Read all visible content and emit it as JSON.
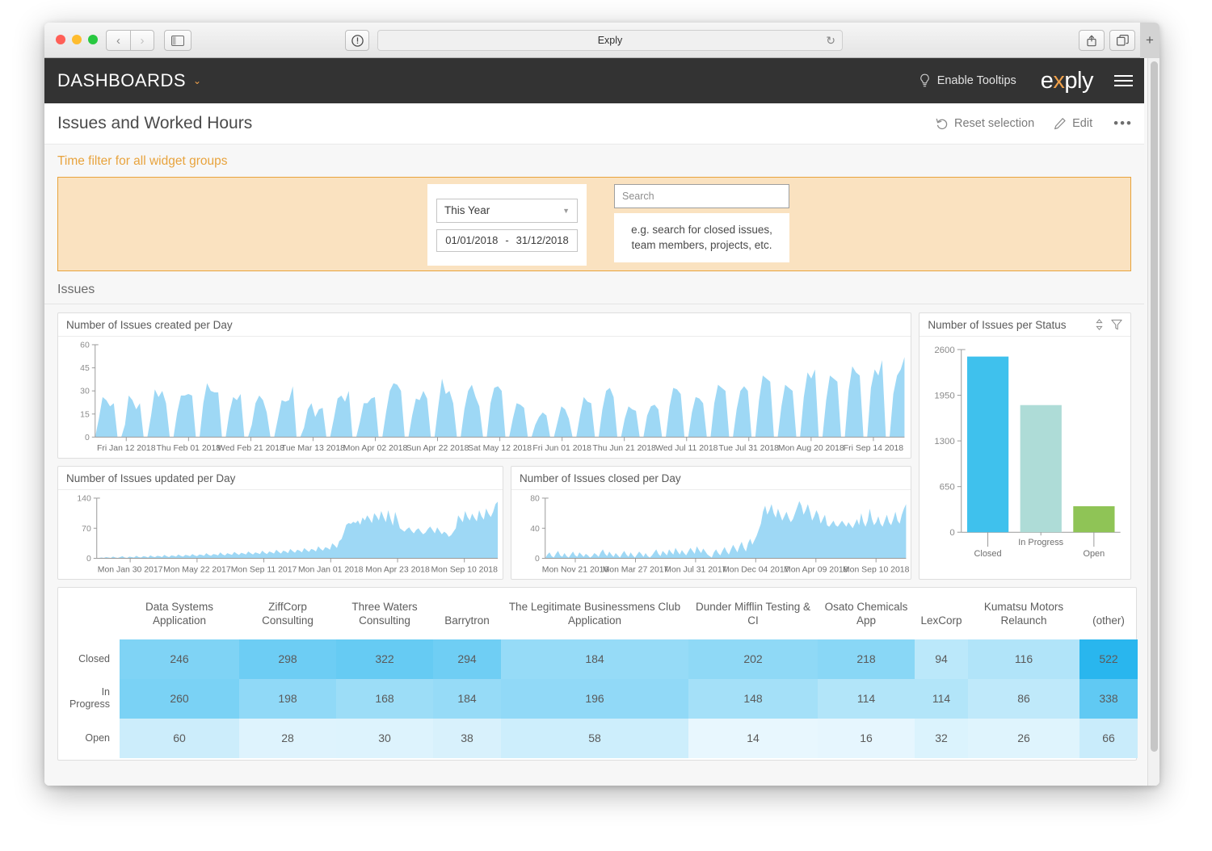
{
  "browser": {
    "traffic_lights": [
      "close",
      "minimize",
      "maximize"
    ],
    "back_label": "‹",
    "forward_label": "›",
    "url_text": "Exply",
    "reload_label": "↻",
    "newtab_label": "+"
  },
  "appbar": {
    "brand": "DASHBOARDS",
    "brand_caret": "⌄",
    "tooltips_label": "Enable Tooltips",
    "logo_pre": "e",
    "logo_x": "x",
    "logo_post": "ply"
  },
  "title_row": {
    "dashboard_title": "Issues and Worked Hours",
    "reset_label": "Reset selection",
    "edit_label": "Edit",
    "more_label": "•••"
  },
  "time_filter": {
    "caption": "Time filter for all widget groups",
    "period_value": "This Year",
    "period_options": [
      "This Year"
    ],
    "date_from": "01/01/2018",
    "date_sep": "-",
    "date_to": "31/12/2018",
    "search_placeholder": "Search",
    "search_value": "",
    "search_hint_line1": "e.g. search for closed issues,",
    "search_hint_line2": "team members, projects, etc."
  },
  "group": {
    "label": "Issues"
  },
  "colors": {
    "accent_orange": "#e8a33d",
    "panel_bg": "#fae2c0",
    "appbar_bg": "#333333",
    "area_blue": "#9ed8f5",
    "bar_closed": "#3fc1ed",
    "bar_inprogress": "#aedcd7",
    "bar_open": "#8fc456"
  },
  "widgets": {
    "created": {
      "title": "Number of Issues created per Day"
    },
    "updated": {
      "title": "Number of Issues updated per Day"
    },
    "closed": {
      "title": "Number of Issues closed per Day"
    },
    "status": {
      "title": "Number of Issues per Status"
    }
  },
  "chart_data": [
    {
      "id": "issues-created-per-day",
      "type": "area",
      "title": "Number of Issues created per Day",
      "xlabel": "",
      "ylabel": "",
      "ylim": [
        0,
        60
      ],
      "yticks": [
        0,
        15,
        30,
        45,
        60
      ],
      "grid": false,
      "legend": "none",
      "xticks": [
        "Fri Jan 12 2018",
        "Thu Feb 01 2018",
        "Wed Feb 21 2018",
        "Tue Mar 13 2018",
        "Mon Apr 02 2018",
        "Sun Apr 22 2018",
        "Sat May 12 2018",
        "Fri Jun 01 2018",
        "Thu Jun 21 2018",
        "Wed Jul 11 2018",
        "Tue Jul 31 2018",
        "Mon Aug 20 2018",
        "Fri Sep 14 2018"
      ],
      "values": [
        0,
        12,
        26,
        24,
        20,
        22,
        0,
        0,
        8,
        27,
        24,
        18,
        22,
        0,
        0,
        14,
        31,
        26,
        30,
        22,
        0,
        0,
        16,
        27,
        27,
        28,
        27,
        0,
        0,
        22,
        35,
        30,
        29,
        29,
        0,
        0,
        16,
        26,
        24,
        28,
        0,
        0,
        8,
        22,
        27,
        24,
        16,
        0,
        0,
        12,
        24,
        23,
        24,
        33,
        0,
        0,
        6,
        18,
        22,
        13,
        18,
        19,
        0,
        0,
        12,
        25,
        27,
        23,
        30,
        0,
        0,
        10,
        22,
        22,
        25,
        26,
        0,
        0,
        16,
        30,
        35,
        34,
        30,
        0,
        0,
        14,
        25,
        24,
        30,
        25,
        0,
        0,
        20,
        38,
        28,
        30,
        22,
        0,
        0,
        18,
        30,
        34,
        26,
        20,
        0,
        0,
        22,
        32,
        33,
        30,
        0,
        0,
        12,
        22,
        21,
        19,
        0,
        0,
        8,
        13,
        16,
        14,
        0,
        0,
        10,
        20,
        18,
        12,
        0,
        0,
        14,
        26,
        23,
        22,
        0,
        0,
        18,
        30,
        32,
        26,
        0,
        0,
        12,
        20,
        18,
        17,
        0,
        0,
        14,
        20,
        21,
        18,
        0,
        0,
        20,
        32,
        31,
        28,
        0,
        0,
        16,
        26,
        25,
        22,
        0,
        0,
        22,
        34,
        32,
        30,
        0,
        0,
        18,
        30,
        33,
        30,
        0,
        0,
        24,
        40,
        38,
        36,
        0,
        0,
        20,
        34,
        32,
        30,
        0,
        0,
        26,
        42,
        38,
        44,
        0,
        0,
        24,
        40,
        38,
        36,
        0,
        0,
        30,
        46,
        42,
        40,
        0,
        0,
        32,
        44,
        40,
        50,
        0,
        0,
        28,
        40,
        44,
        52
      ]
    },
    {
      "id": "issues-updated-per-day",
      "type": "area",
      "title": "Number of Issues updated per Day",
      "ylim": [
        0,
        140
      ],
      "yticks": [
        0,
        70,
        140
      ],
      "grid": false,
      "legend": "none",
      "xticks": [
        "Mon Jan 30 2017",
        "Mon May 22 2017",
        "Mon Sep 11 2017",
        "Mon Jan 01 2018",
        "Mon Apr 23 2018",
        "Mon Sep 10 2018"
      ],
      "values": [
        0,
        1,
        2,
        1,
        3,
        2,
        1,
        4,
        2,
        1,
        3,
        5,
        2,
        1,
        4,
        3,
        2,
        6,
        3,
        2,
        5,
        4,
        2,
        7,
        4,
        3,
        6,
        5,
        3,
        8,
        5,
        3,
        7,
        6,
        4,
        9,
        6,
        4,
        8,
        7,
        5,
        10,
        7,
        5,
        9,
        8,
        6,
        12,
        8,
        6,
        10,
        9,
        7,
        14,
        9,
        7,
        12,
        10,
        8,
        15,
        11,
        8,
        13,
        11,
        9,
        16,
        12,
        9,
        14,
        12,
        10,
        18,
        13,
        10,
        16,
        14,
        11,
        20,
        15,
        11,
        18,
        16,
        12,
        22,
        17,
        13,
        20,
        18,
        14,
        24,
        19,
        15,
        22,
        20,
        16,
        28,
        22,
        18,
        26,
        24,
        20,
        35,
        30,
        24,
        40,
        45,
        60,
        78,
        82,
        80,
        85,
        82,
        88,
        78,
        95,
        88,
        100,
        92,
        82,
        105,
        98,
        88,
        110,
        96,
        84,
        112,
        92,
        76,
        108,
        90,
        70,
        66,
        62,
        68,
        72,
        64,
        58,
        66,
        70,
        62,
        56,
        60,
        68,
        74,
        66,
        58,
        72,
        64,
        56,
        62,
        58,
        50,
        54,
        62,
        70,
        100,
        92,
        84,
        110,
        96,
        88,
        104,
        94,
        86,
        112,
        98,
        90,
        116,
        104,
        96,
        108,
        126,
        132
      ]
    },
    {
      "id": "issues-closed-per-day",
      "type": "area",
      "title": "Number of Issues closed per Day",
      "ylim": [
        0,
        80
      ],
      "yticks": [
        0,
        40,
        80
      ],
      "grid": false,
      "legend": "none",
      "xticks": [
        "Mon Nov 21 2016",
        "Mon Mar 27 2017",
        "Mon Jul 31 2017",
        "Mon Dec 04 2017",
        "Mon Apr 09 2018",
        "Mon Sep 10 2018"
      ],
      "values": [
        0,
        5,
        8,
        3,
        1,
        6,
        10,
        4,
        2,
        7,
        3,
        1,
        5,
        9,
        4,
        2,
        8,
        5,
        2,
        6,
        4,
        1,
        3,
        7,
        5,
        2,
        8,
        12,
        6,
        3,
        9,
        5,
        2,
        7,
        4,
        1,
        6,
        10,
        5,
        2,
        8,
        4,
        1,
        5,
        9,
        6,
        2,
        7,
        3,
        1,
        4,
        8,
        12,
        6,
        3,
        10,
        7,
        4,
        12,
        8,
        5,
        14,
        9,
        5,
        11,
        7,
        4,
        9,
        14,
        10,
        6,
        16,
        11,
        7,
        13,
        9,
        5,
        3,
        1,
        8,
        12,
        7,
        4,
        10,
        15,
        9,
        5,
        12,
        18,
        13,
        8,
        16,
        22,
        14,
        9,
        20,
        26,
        18,
        24,
        30,
        38,
        46,
        62,
        70,
        58,
        64,
        72,
        60,
        54,
        66,
        58,
        50,
        56,
        62,
        54,
        48,
        52,
        60,
        68,
        76,
        70,
        58,
        64,
        72,
        62,
        50,
        56,
        64,
        58,
        46,
        52,
        58,
        44,
        42,
        46,
        50,
        44,
        42,
        46,
        50,
        46,
        42,
        48,
        44,
        40,
        46,
        52,
        44,
        60,
        48,
        42,
        50,
        66,
        52,
        44,
        48,
        56,
        46,
        42,
        50,
        58,
        48,
        44,
        52,
        62,
        50,
        46,
        58,
        66,
        72
      ]
    },
    {
      "id": "issues-per-status",
      "type": "bar",
      "title": "Number of Issues per Status",
      "categories": [
        "Closed",
        "In Progress",
        "Open"
      ],
      "values": [
        2500,
        1810,
        370
      ],
      "colors": [
        "#3fc1ed",
        "#aedcd7",
        "#8fc456"
      ],
      "ylim": [
        0,
        2600
      ],
      "yticks": [
        0,
        650,
        1300,
        1950,
        2600
      ],
      "grid": false,
      "legend": "none"
    },
    {
      "id": "issues-by-project-and-status",
      "type": "heatmap",
      "title": "",
      "columns": [
        "Data Systems Application",
        "ZiffCorp Consulting",
        "Three Waters Consulting",
        "Barrytron",
        "The Legitimate Businessmens Club Application",
        "Dunder Mifflin Testing & CI",
        "Osato Chemicals App",
        "LexCorp",
        "Kumatsu Motors Relaunch",
        "(other)"
      ],
      "rows": [
        "Closed",
        "In Progress",
        "Open"
      ],
      "values": [
        [
          246,
          298,
          322,
          294,
          184,
          202,
          218,
          94,
          116,
          522
        ],
        [
          260,
          198,
          168,
          184,
          196,
          148,
          114,
          114,
          86,
          338
        ],
        [
          60,
          28,
          30,
          38,
          58,
          14,
          16,
          32,
          26,
          66
        ]
      ]
    }
  ]
}
